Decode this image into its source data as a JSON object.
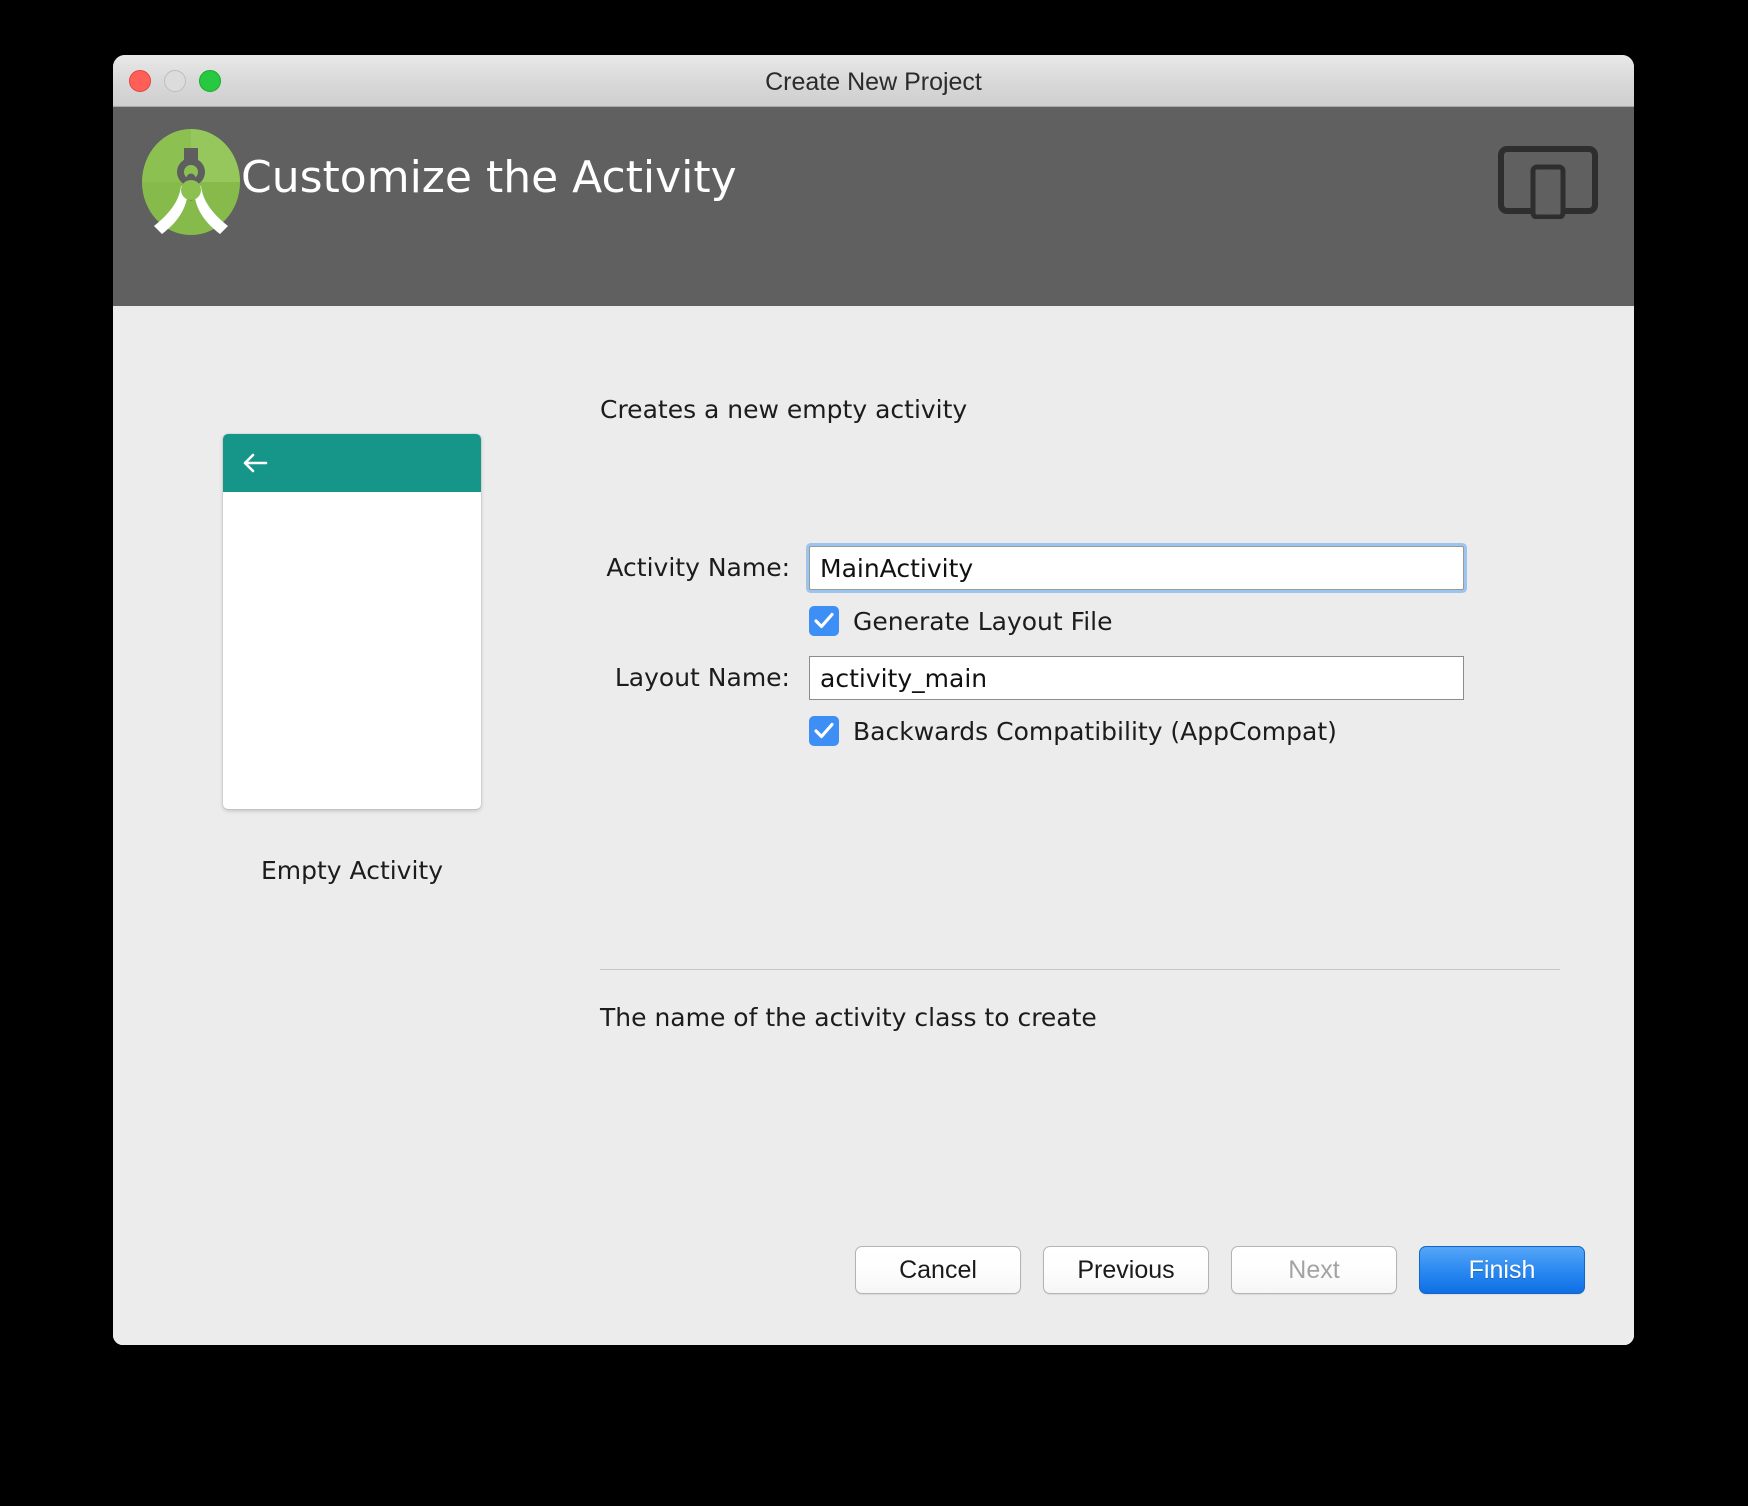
{
  "window": {
    "title": "Create New Project",
    "controls": {
      "close": "close-button",
      "minimize": "minimize-button",
      "maximize": "maximize-button"
    }
  },
  "header": {
    "title": "Customize the Activity",
    "logo_icon": "android-studio-logo",
    "device_icon": "tablet-phone-icon",
    "background": "#606060"
  },
  "preview": {
    "back_icon": "back-arrow-icon",
    "label": "Empty Activity",
    "appbar_color": "#169688"
  },
  "form": {
    "description": "Creates a new empty activity",
    "activity_name": {
      "label": "Activity Name:",
      "value": "MainActivity",
      "placeholder": "Activity Name"
    },
    "generate_layout": {
      "label": "Generate Layout File",
      "checked": true
    },
    "layout_name": {
      "label": "Layout Name:",
      "value": "activity_main",
      "placeholder": "Layout Name"
    },
    "backwards_compatibility": {
      "label": "Backwards Compatibility (AppCompat)",
      "checked": true
    },
    "help_text": "The name of the activity class to create"
  },
  "footer": {
    "cancel": "Cancel",
    "previous": "Previous",
    "next": "Next",
    "finish": "Finish",
    "primary_color": "#2d8bf2"
  }
}
